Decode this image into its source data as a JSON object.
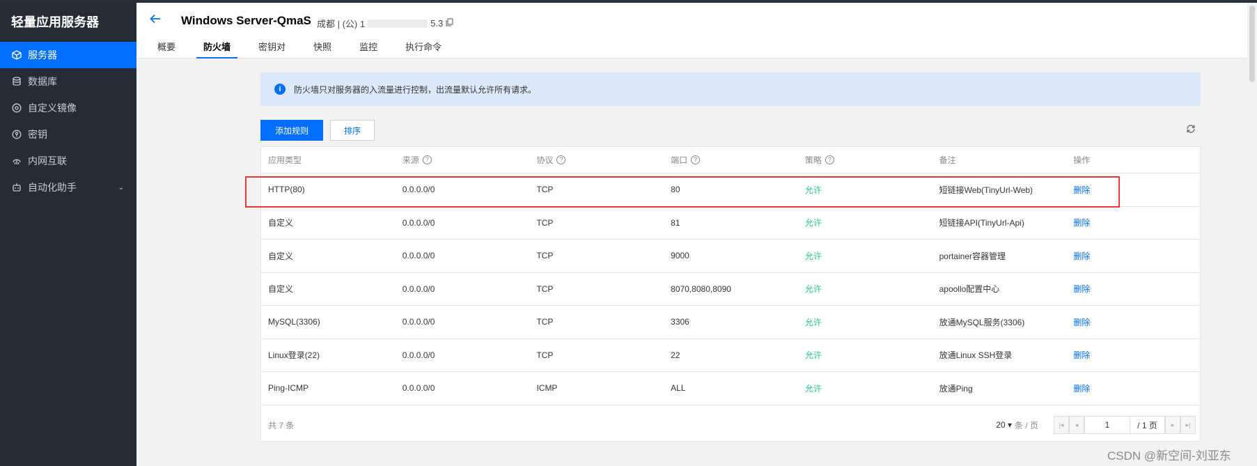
{
  "sidebar": {
    "brand": "轻量应用服务器",
    "items": [
      {
        "label": "服务器",
        "icon": "cube-icon",
        "active": true
      },
      {
        "label": "数据库",
        "icon": "database-icon"
      },
      {
        "label": "自定义镜像",
        "icon": "disc-icon"
      },
      {
        "label": "密钥",
        "icon": "key-icon"
      },
      {
        "label": "内网互联",
        "icon": "link-icon"
      },
      {
        "label": "自动化助手",
        "icon": "robot-icon",
        "caret": "⌄"
      }
    ]
  },
  "header": {
    "title": "Windows Server-QmaS",
    "region_prefix": "成都 | (公) 1",
    "region_suffix": "5.3",
    "tabs": [
      "概要",
      "防火墙",
      "密钥对",
      "快照",
      "监控",
      "执行命令"
    ],
    "active_tab": "防火墙"
  },
  "notice": {
    "text": "防火墙只对服务器的入流量进行控制，出流量默认允许所有请求。"
  },
  "toolbar": {
    "add_rule": "添加规则",
    "sort": "排序"
  },
  "table": {
    "columns": [
      "应用类型",
      "来源",
      "协议",
      "端口",
      "策略",
      "备注",
      "操作"
    ],
    "rows": [
      [
        "HTTP(80)",
        "0.0.0.0/0",
        "TCP",
        "80",
        "允许",
        "短链接Web(TinyUrl-Web)",
        "删除"
      ],
      [
        "自定义",
        "0.0.0.0/0",
        "TCP",
        "81",
        "允许",
        "短链接API(TinyUrl-Api)",
        "删除"
      ],
      [
        "自定义",
        "0.0.0.0/0",
        "TCP",
        "9000",
        "允许",
        "portainer容器管理",
        "删除"
      ],
      [
        "自定义",
        "0.0.0.0/0",
        "TCP",
        "8070,8080,8090",
        "允许",
        "apoollo配置中心",
        "删除"
      ],
      [
        "MySQL(3306)",
        "0.0.0.0/0",
        "TCP",
        "3306",
        "允许",
        "放通MySQL服务(3306)",
        "删除"
      ],
      [
        "Linux登录(22)",
        "0.0.0.0/0",
        "TCP",
        "22",
        "允许",
        "放通Linux SSH登录",
        "删除"
      ],
      [
        "Ping-ICMP",
        "0.0.0.0/0",
        "ICMP",
        "ALL",
        "允许",
        "放通Ping",
        "删除"
      ]
    ],
    "total": "共 7 条",
    "page_size": "20 ▾",
    "page_size_unit": "条 / 页",
    "current_page": "1",
    "total_pages": "/ 1 页"
  },
  "watermark": "CSDN @新空间-刘亚东",
  "colors": {
    "accent": "#006eff",
    "sidebar_bg": "#262b36",
    "allow": "#29cc85",
    "notice_bg": "#dbe9fb",
    "highlight": "#e53935"
  }
}
